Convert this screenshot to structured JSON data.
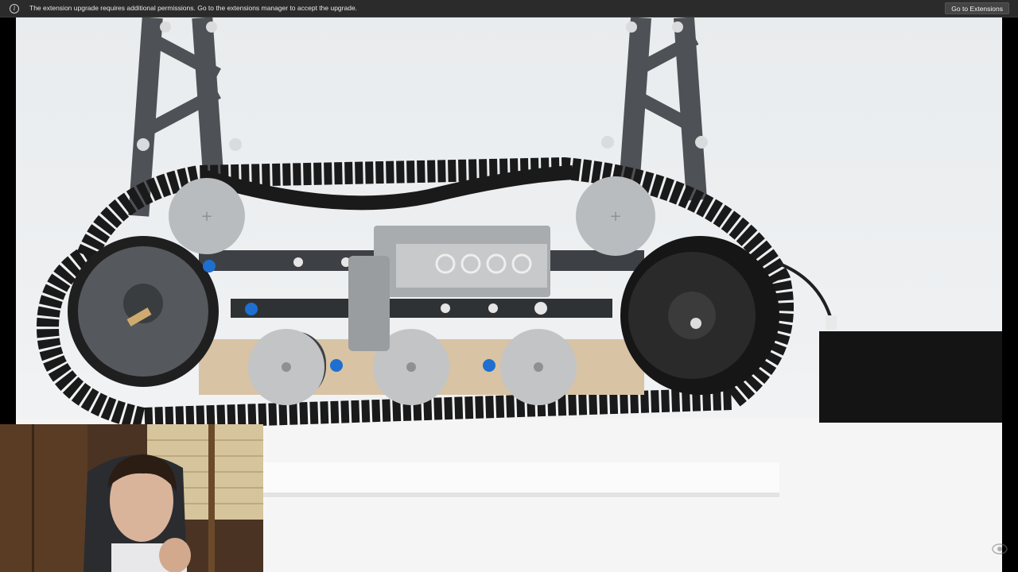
{
  "notification": {
    "icon": "info-icon",
    "message": "The extension upgrade requires additional permissions. Go to the extensions manager to accept the upgrade.",
    "button_label": "Go to Extensions"
  },
  "video": {
    "description_icon": "video-frame"
  },
  "colors": {
    "bar_bg": "#2b2b2b",
    "track": "#1c1c1c",
    "frame": "#4b4e52",
    "wheel_light": "#b9bcbf",
    "wheel_dark": "#5c5f63",
    "accent_blue": "#1e6fd0"
  }
}
